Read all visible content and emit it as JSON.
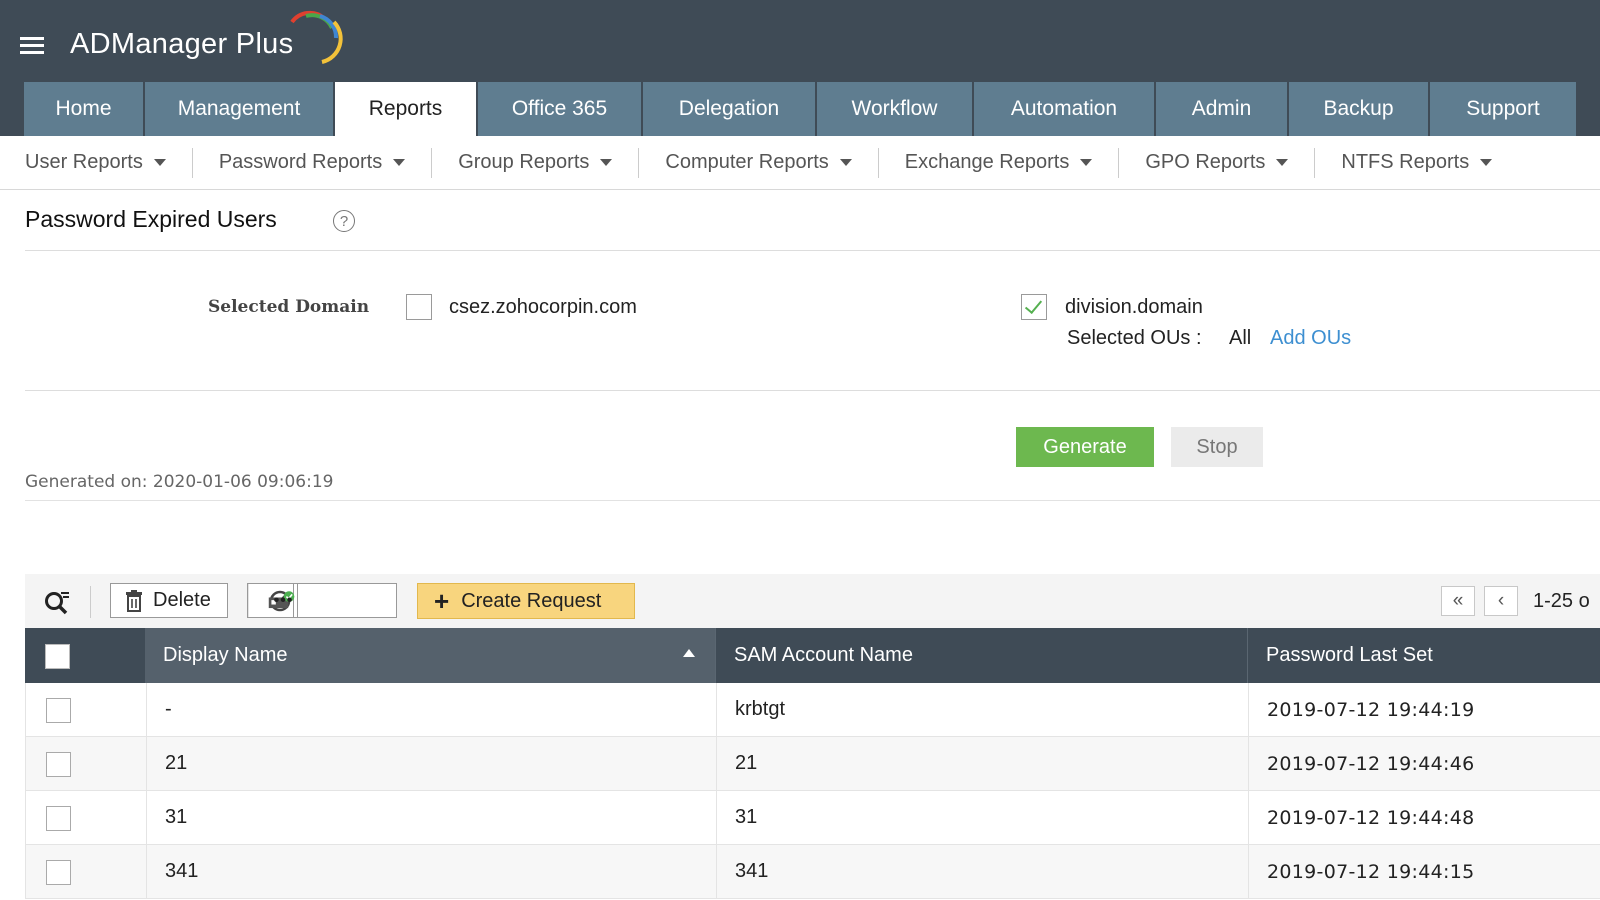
{
  "app": {
    "name": "ADManager Plus"
  },
  "main_nav": {
    "tabs": [
      {
        "label": "Home"
      },
      {
        "label": "Management"
      },
      {
        "label": "Reports",
        "active": true
      },
      {
        "label": "Office 365"
      },
      {
        "label": "Delegation"
      },
      {
        "label": "Workflow"
      },
      {
        "label": "Automation"
      },
      {
        "label": "Admin"
      },
      {
        "label": "Backup"
      },
      {
        "label": "Support"
      }
    ]
  },
  "sub_nav": {
    "items": [
      {
        "label": "User Reports"
      },
      {
        "label": "Password Reports"
      },
      {
        "label": "Group Reports"
      },
      {
        "label": "Computer Reports"
      },
      {
        "label": "Exchange Reports"
      },
      {
        "label": "GPO Reports"
      },
      {
        "label": "NTFS Reports"
      }
    ]
  },
  "page": {
    "title": "Password Expired Users",
    "help_symbol": "?"
  },
  "domain_section": {
    "label": "Selected Domain",
    "domains": [
      {
        "name": "csez.zohocorpin.com",
        "checked": false
      },
      {
        "name": "division.domain",
        "checked": true
      }
    ],
    "ou_label": "Selected OUs :",
    "ou_value": "All",
    "add_ous_link": "Add OUs"
  },
  "actions": {
    "generate_label": "Generate",
    "stop_label": "Stop",
    "generated_on": "Generated on: 2020-01-06 09:06:19"
  },
  "toolbar": {
    "delete_label": "Delete",
    "create_request_label": "Create Request",
    "create_request_symbol": "+",
    "more_symbol": "•••",
    "first_symbol": "«",
    "prev_symbol": "‹",
    "page_range": "1-25 o"
  },
  "table": {
    "columns": [
      "Display Name",
      "SAM Account Name",
      "Password Last Set"
    ],
    "rows": [
      {
        "display_name": "-",
        "sam": "krbtgt",
        "pwd_last_set": "2019-07-12 19:44:19"
      },
      {
        "display_name": "21",
        "sam": "21",
        "pwd_last_set": "2019-07-12 19:44:46"
      },
      {
        "display_name": "31",
        "sam": "31",
        "pwd_last_set": "2019-07-12 19:44:48"
      },
      {
        "display_name": "341",
        "sam": "341",
        "pwd_last_set": "2019-07-12 19:44:15"
      }
    ]
  },
  "colors": {
    "header_bg": "#3f4b56",
    "tab_bg": "#5f7d90",
    "generate_green": "#6db84f",
    "link_blue": "#3d8fd1",
    "create_request_bg": "#f8d57e"
  },
  "icons": {
    "menu": "hamburger-icon",
    "help": "help-icon",
    "search": "search-filter-icon",
    "delete": "trash-icon",
    "disable": "disable-icon",
    "enable": "enable-user-icon",
    "more": "more-icon"
  }
}
